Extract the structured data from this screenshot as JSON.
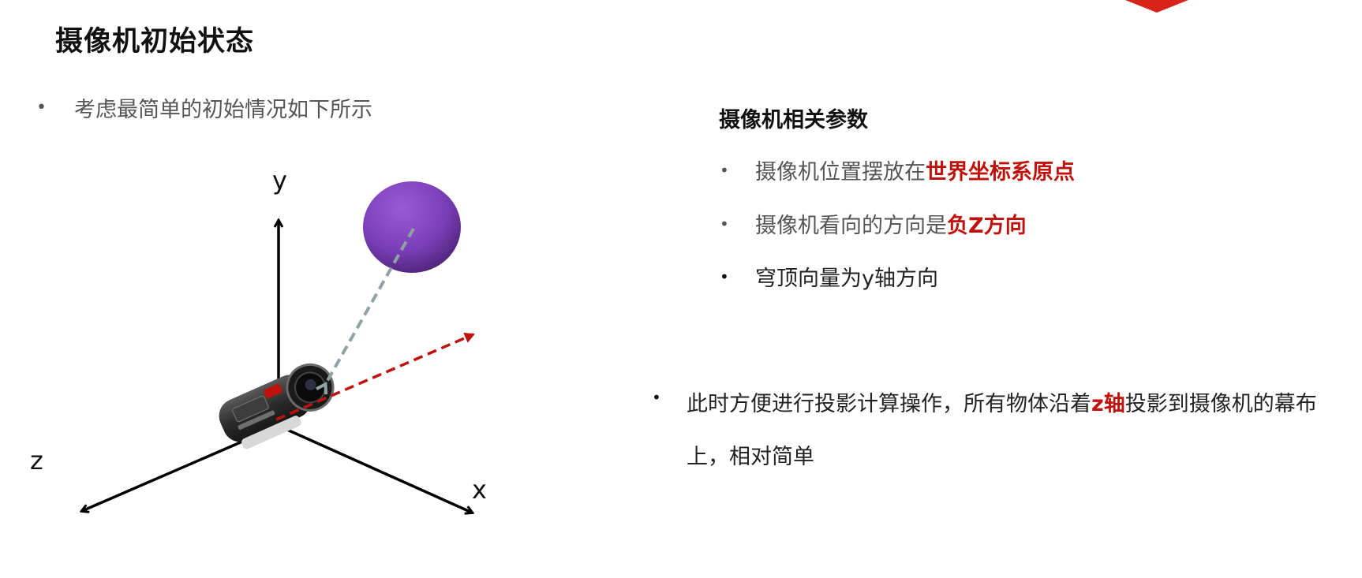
{
  "slide": {
    "title": "摄像机初始状态",
    "intro_bullet": "考虑最简单的初始情况如下所示",
    "bullet_symbol": "•",
    "params": {
      "heading": "摄像机相关参数",
      "items": [
        {
          "prefix": "摄像机位置摆放在",
          "highlight": "世界坐标系原点",
          "suffix": ""
        },
        {
          "prefix": "摄像机看向的方向是",
          "highlight": "负Z方向",
          "suffix": ""
        },
        {
          "prefix": "穹顶向量为y轴方向",
          "highlight": "",
          "suffix": ""
        }
      ]
    },
    "note": {
      "line1_prefix": "此时方便进行投影计算操作，所有物体沿着",
      "line1_highlight": "z轴",
      "line1_suffix": "投影到摄像机的幕布",
      "line2": "上，相对简单"
    }
  },
  "diagram": {
    "axis_labels": {
      "x": "x",
      "y": "y",
      "z": "z"
    },
    "colors": {
      "axes": "#000000",
      "sphere_top": "#8a4cc4",
      "sphere_bottom": "#5a2a86",
      "projection_dashed": "#8fa2a6",
      "look_dashed": "#c0120c",
      "highlight_text": "#c0120c",
      "corner_mark": "#d8231a"
    },
    "icons": [
      "camera-icon",
      "sphere-object"
    ]
  }
}
